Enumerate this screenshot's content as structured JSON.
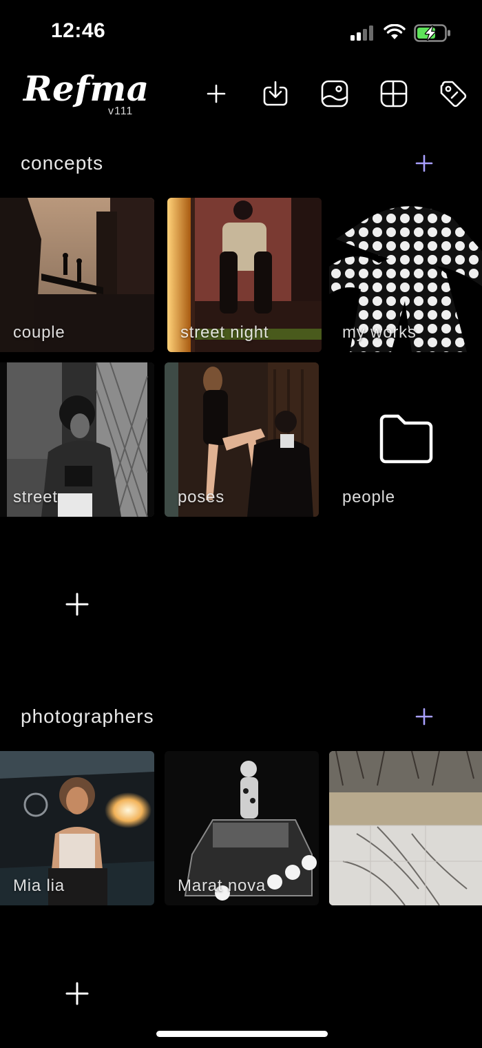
{
  "status_bar": {
    "time": "12:46"
  },
  "header": {
    "logo": "Refma",
    "version": "v111",
    "toolbar_icons": [
      "plus-icon",
      "download-icon",
      "image-icon",
      "grid-icon",
      "tag-icon"
    ]
  },
  "sections": [
    {
      "title": "concepts",
      "items": [
        {
          "label": "couple"
        },
        {
          "label": "street night"
        },
        {
          "label": "my works"
        },
        {
          "label": "street"
        },
        {
          "label": "poses"
        },
        {
          "label": "people"
        }
      ]
    },
    {
      "title": "photographers",
      "items": [
        {
          "label": "Mia lia"
        },
        {
          "label": "Marat nova"
        },
        {
          "label": ""
        }
      ]
    }
  ],
  "colors": {
    "accent": "#a9a0ff",
    "background": "#000000",
    "battery": "#5ee35a"
  }
}
